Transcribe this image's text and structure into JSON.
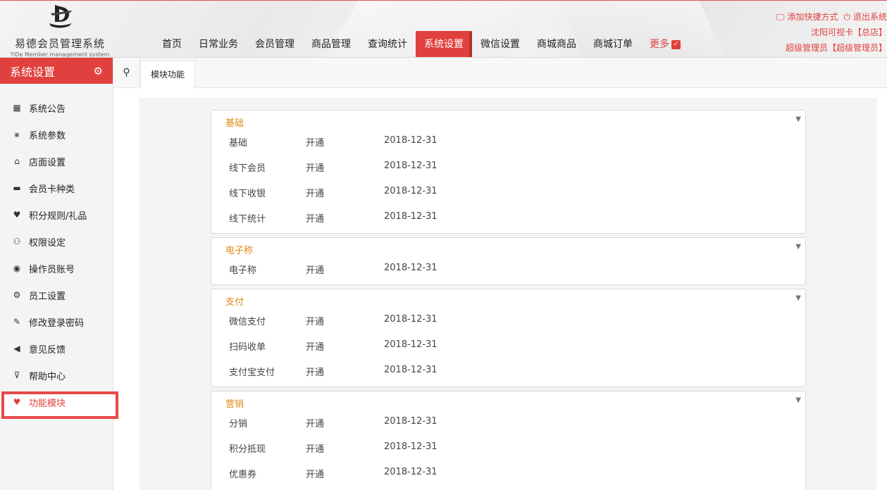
{
  "brand": {
    "title": "易德会员管理系统",
    "subtitle": "YiDe Member management system"
  },
  "nav": {
    "items": [
      {
        "label": "首页",
        "active": false
      },
      {
        "label": "日常业务",
        "active": false
      },
      {
        "label": "会员管理",
        "active": false
      },
      {
        "label": "商品管理",
        "active": false
      },
      {
        "label": "查询统计",
        "active": false
      },
      {
        "label": "系统设置",
        "active": true
      },
      {
        "label": "微信设置",
        "active": false
      },
      {
        "label": "商城商品",
        "active": false
      },
      {
        "label": "商城订单",
        "active": false
      }
    ],
    "more_label": "更多"
  },
  "top_right": {
    "add_shortcut": "添加快捷方式",
    "logout": "退出系统",
    "store_line": "沈阳可视卡【总店】",
    "user_line": "超级管理员【超级管理员】"
  },
  "sidebar": {
    "title": "系统设置",
    "items": [
      {
        "label": "系统公告",
        "icon": "calendar-icon",
        "active": false
      },
      {
        "label": "系统参数",
        "icon": "tools-icon",
        "active": false
      },
      {
        "label": "店面设置",
        "icon": "home-icon",
        "active": false
      },
      {
        "label": "会员卡种类",
        "icon": "card-icon",
        "active": false
      },
      {
        "label": "积分规则/礼品",
        "icon": "heart-icon",
        "active": false
      },
      {
        "label": "权限设定",
        "icon": "users-icon",
        "active": false
      },
      {
        "label": "操作员账号",
        "icon": "user-circle-icon",
        "active": false
      },
      {
        "label": "员工设置",
        "icon": "gear-icon",
        "active": false
      },
      {
        "label": "修改登录密码",
        "icon": "edit-icon",
        "active": false
      },
      {
        "label": "意见反馈",
        "icon": "megaphone-icon",
        "active": false
      },
      {
        "label": "帮助中心",
        "icon": "basket-icon",
        "active": false
      },
      {
        "label": "功能模块",
        "icon": "heart-icon",
        "active": true
      }
    ]
  },
  "tabs": {
    "active_tab": "模块功能"
  },
  "modules": [
    {
      "group": "基础",
      "rows": [
        {
          "name": "基础",
          "status": "开通",
          "date": "2018-12-31"
        },
        {
          "name": "线下会员",
          "status": "开通",
          "date": "2018-12-31"
        },
        {
          "name": "线下收银",
          "status": "开通",
          "date": "2018-12-31"
        },
        {
          "name": "线下统计",
          "status": "开通",
          "date": "2018-12-31"
        }
      ]
    },
    {
      "group": "电子称",
      "rows": [
        {
          "name": "电子称",
          "status": "开通",
          "date": "2018-12-31"
        }
      ]
    },
    {
      "group": "支付",
      "rows": [
        {
          "name": "微信支付",
          "status": "开通",
          "date": "2018-12-31"
        },
        {
          "name": "扫码收单",
          "status": "开通",
          "date": "2018-12-31"
        },
        {
          "name": "支付宝支付",
          "status": "开通",
          "date": "2018-12-31"
        }
      ]
    },
    {
      "group": "营销",
      "rows": [
        {
          "name": "分销",
          "status": "开通",
          "date": "2018-12-31"
        },
        {
          "name": "积分抵现",
          "status": "开通",
          "date": "2018-12-31"
        },
        {
          "name": "优惠券",
          "status": "开通",
          "date": "2018-12-31"
        }
      ]
    }
  ],
  "colors": {
    "accent": "#e0413e",
    "group_title": "#e08a1a"
  }
}
